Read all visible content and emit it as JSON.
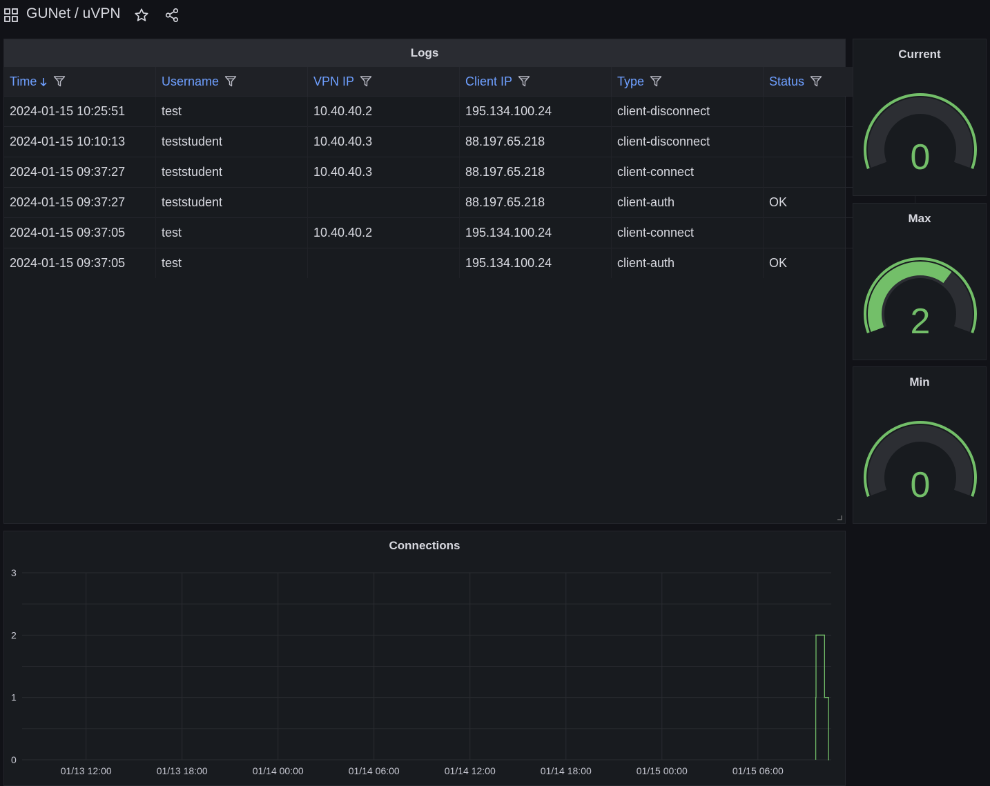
{
  "header": {
    "breadcrumb": "GUNet / uVPN",
    "icons": [
      "apps-icon",
      "star-icon",
      "share-icon"
    ]
  },
  "logs": {
    "title": "Logs",
    "columns": [
      "Time",
      "Username",
      "VPN IP",
      "Client IP",
      "Type",
      "Status"
    ],
    "sorted_column": "Time",
    "rows": [
      [
        "2024-01-15 10:25:51",
        "test",
        "10.40.40.2",
        "195.134.100.24",
        "client-disconnect",
        ""
      ],
      [
        "2024-01-15 10:10:13",
        "teststudent",
        "10.40.40.3",
        "88.197.65.218",
        "client-disconnect",
        ""
      ],
      [
        "2024-01-15 09:37:27",
        "teststudent",
        "10.40.40.3",
        "88.197.65.218",
        "client-connect",
        ""
      ],
      [
        "2024-01-15 09:37:27",
        "teststudent",
        "",
        "88.197.65.218",
        "client-auth",
        "OK"
      ],
      [
        "2024-01-15 09:37:05",
        "test",
        "10.40.40.2",
        "195.134.100.24",
        "client-connect",
        ""
      ],
      [
        "2024-01-15 09:37:05",
        "test",
        "",
        "195.134.100.24",
        "client-auth",
        "OK"
      ]
    ]
  },
  "gauges": [
    {
      "id": "current",
      "title": "Current",
      "value": 0,
      "min": 0,
      "max": 3
    },
    {
      "id": "max",
      "title": "Max",
      "value": 2,
      "min": 0,
      "max": 3
    },
    {
      "id": "min",
      "title": "Min",
      "value": 0,
      "min": 0,
      "max": 3
    }
  ],
  "colors": {
    "accent_blue": "#6e9fff",
    "series_green": "#73bf69",
    "gauge_track": "#2c2e33",
    "background": "#111217",
    "panel": "#181b1f"
  },
  "chart_data": {
    "type": "line",
    "title": "Connections",
    "xlabel": "",
    "ylabel": "",
    "ylim": [
      0,
      3
    ],
    "yticks": [
      0,
      1,
      2,
      3
    ],
    "xlim": [
      "2024-01-13 08:00",
      "2024-01-15 10:35"
    ],
    "xticks": [
      "01/13 12:00",
      "01/13 18:00",
      "01/14 00:00",
      "01/14 06:00",
      "01/14 12:00",
      "01/14 18:00",
      "01/15 00:00",
      "01/15 06:00"
    ],
    "grid": true,
    "interpolation": "step",
    "series": [
      {
        "color": "#73bf69",
        "points": [
          {
            "x": "2024-01-15 09:37",
            "y": 1
          },
          {
            "x": "2024-01-15 09:38",
            "y": 2
          },
          {
            "x": "2024-01-15 10:10",
            "y": 1
          },
          {
            "x": "2024-01-15 10:25",
            "y": 0
          }
        ]
      }
    ]
  }
}
